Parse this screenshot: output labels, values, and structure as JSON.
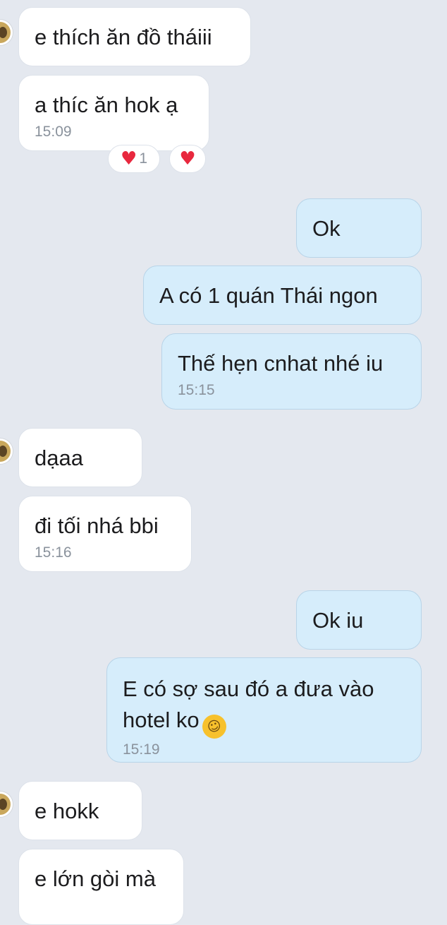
{
  "messages": [
    {
      "text": "e thích ăn đồ tháiii",
      "time": ""
    },
    {
      "text": "a thíc ăn hok ạ",
      "time": "15:09"
    },
    {
      "text": "Ok",
      "time": ""
    },
    {
      "text": "A có 1 quán Thái ngon",
      "time": ""
    },
    {
      "text": "Thế hẹn cnhat nhé iu",
      "time": "15:15"
    },
    {
      "text": "dạaa",
      "time": ""
    },
    {
      "text": "đi tối nhá bbi",
      "time": "15:16"
    },
    {
      "text": "Ok iu",
      "time": ""
    },
    {
      "text": "E có sợ sau đó a đưa vào\nhotel ko",
      "time": "15:19"
    },
    {
      "text": "e hokk",
      "time": ""
    },
    {
      "text": "e lớn gòi mà",
      "time": ""
    }
  ],
  "reactions": {
    "count": "1",
    "icon": "heart-icon",
    "color": "#e8283e"
  },
  "emoji": {
    "name": "rolling-on-floor-laughing-emoji"
  },
  "colors": {
    "background": "#e4e8ef",
    "incoming_bubble": "#ffffff",
    "outgoing_bubble": "#d6edfb",
    "timestamp": "#8a929c"
  }
}
